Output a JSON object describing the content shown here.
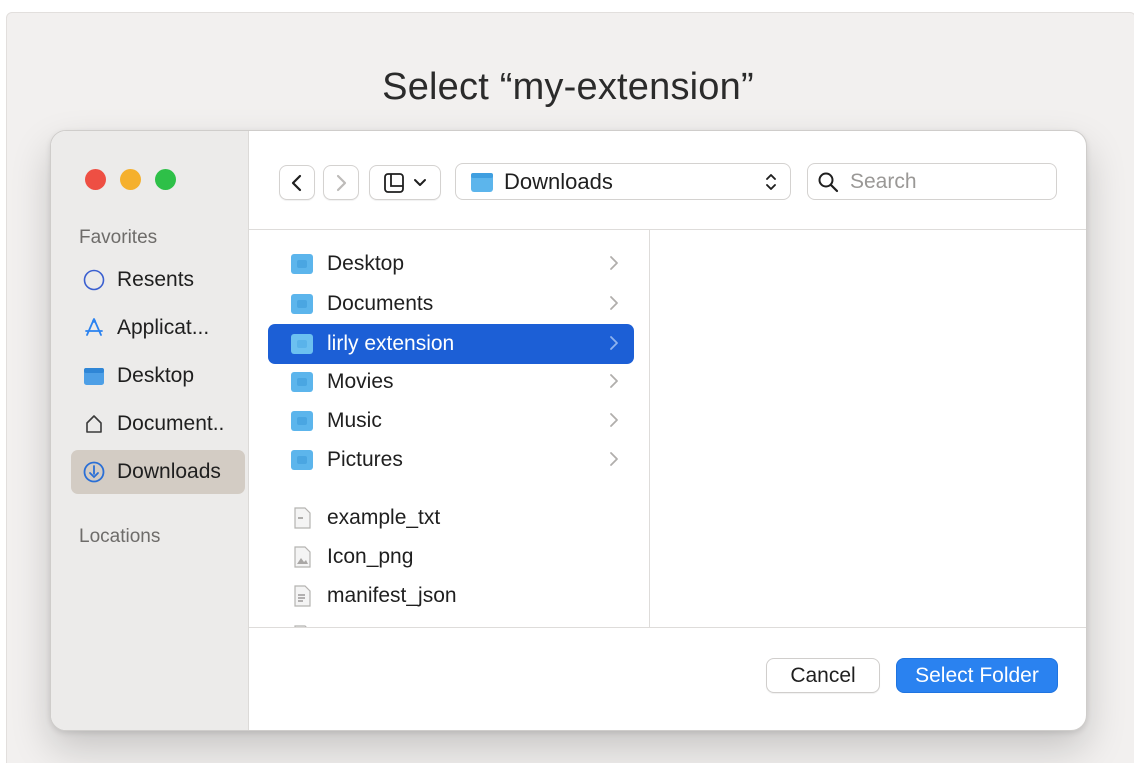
{
  "page_title": "Select “my-extension”",
  "sidebar": {
    "favorites_label": "Favorites",
    "locations_label": "Locations",
    "items": [
      {
        "label": "Resents",
        "icon": "clock-circle-icon"
      },
      {
        "label": "Applicat...",
        "icon": "applications-icon"
      },
      {
        "label": "Desktop",
        "icon": "desktop-folder-icon"
      },
      {
        "label": "Document..",
        "icon": "document-icon"
      },
      {
        "label": "Downloads",
        "icon": "downloads-icon",
        "active": true
      }
    ]
  },
  "toolbar": {
    "location": "Downloads",
    "search_placeholder": "Search"
  },
  "browser": {
    "folders": [
      {
        "label": "Desktop"
      },
      {
        "label": "Documents"
      },
      {
        "label": "lirly extension",
        "selected": true
      },
      {
        "label": "Movies"
      },
      {
        "label": "Music"
      },
      {
        "label": "Pictures"
      }
    ],
    "files": [
      {
        "label": "example_txt"
      },
      {
        "label": "Icon_png"
      },
      {
        "label": "manifest_json"
      }
    ]
  },
  "footer": {
    "cancel_label": "Cancel",
    "primary_label": "Select Folder"
  },
  "colors": {
    "accent": "#2a82f0",
    "selection": "#1c5fd6",
    "sidebar_active": "#d3ccc4",
    "folder": "#5cb5ec"
  }
}
